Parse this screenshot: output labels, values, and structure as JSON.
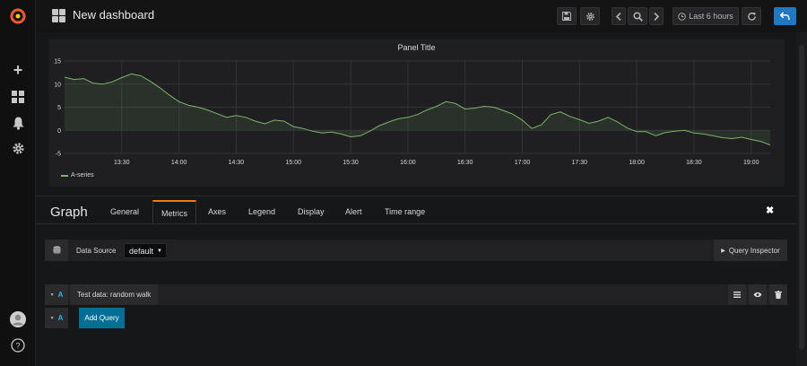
{
  "topbar": {
    "title": "New dashboard",
    "time_range": "Last 6 hours"
  },
  "panel": {
    "title": "Panel Title"
  },
  "chart_data": {
    "type": "line",
    "x": [
      "13:00",
      "13:05",
      "13:10",
      "13:15",
      "13:20",
      "13:25",
      "13:30",
      "13:35",
      "13:40",
      "13:45",
      "13:50",
      "13:55",
      "14:00",
      "14:05",
      "14:10",
      "14:15",
      "14:20",
      "14:25",
      "14:30",
      "14:35",
      "14:40",
      "14:45",
      "14:50",
      "14:55",
      "15:00",
      "15:05",
      "15:10",
      "15:15",
      "15:20",
      "15:25",
      "15:30",
      "15:35",
      "15:40",
      "15:45",
      "15:50",
      "15:55",
      "16:00",
      "16:05",
      "16:10",
      "16:15",
      "16:20",
      "16:25",
      "16:30",
      "16:35",
      "16:40",
      "16:45",
      "16:50",
      "16:55",
      "17:00",
      "17:05",
      "17:10",
      "17:15",
      "17:20",
      "17:25",
      "17:30",
      "17:35",
      "17:40",
      "17:45",
      "17:50",
      "17:55",
      "18:00",
      "18:05",
      "18:10",
      "18:15",
      "18:20",
      "18:25",
      "18:30",
      "18:35",
      "18:40",
      "18:45",
      "18:50",
      "18:55",
      "19:00",
      "19:05",
      "19:10"
    ],
    "series": [
      {
        "name": "A-series",
        "values": [
          11.5,
          11,
          11.2,
          10.2,
          10,
          10.5,
          11.4,
          12.2,
          11.8,
          10.6,
          9.2,
          7.6,
          6.2,
          5.4,
          5,
          4.4,
          3.6,
          2.8,
          3.2,
          2.8,
          2,
          1.4,
          2.2,
          2,
          0.8,
          0.4,
          -0.2,
          -0.6,
          -0.4,
          -0.8,
          -1.4,
          -1.2,
          -0.2,
          1,
          1.8,
          2.5,
          2.8,
          3.4,
          4.4,
          5.2,
          6.2,
          5.8,
          4.6,
          4.8,
          5.2,
          5,
          4.3,
          3.5,
          2.2,
          0.4,
          1.2,
          3.4,
          4,
          3,
          2.3,
          1.5,
          2,
          2.8,
          1.8,
          0.5,
          -0.3,
          -0.3,
          -1.2,
          -0.5,
          -0.2,
          0,
          -0.6,
          -0.8,
          -1.2,
          -1.6,
          -1.8,
          -1.5,
          -2,
          -2.4,
          -3.2
        ]
      }
    ],
    "yticks": [
      "15",
      "10",
      "5",
      "0",
      "-5"
    ],
    "xticks": [
      "13:30",
      "14:00",
      "14:30",
      "15:00",
      "15:30",
      "16:00",
      "16:30",
      "17:00",
      "17:30",
      "18:00",
      "18:30",
      "19:00"
    ],
    "ylim": [
      -5,
      15
    ],
    "grid": true,
    "legend": "bottom-left",
    "colors": {
      "line": "#7eb26d"
    }
  },
  "editor": {
    "title": "Graph",
    "tabs": [
      "General",
      "Metrics",
      "Axes",
      "Legend",
      "Display",
      "Alert",
      "Time range"
    ],
    "active_tab": "Metrics",
    "datasource_label": "Data Source",
    "datasource_value": "default",
    "query_inspector": "Query Inspector",
    "query_letter": "A",
    "query_scenario": "Test data: random walk",
    "add_letter": "A",
    "add_query": "Add Query"
  },
  "colors": {
    "accent": "#eb7b18",
    "primary": "#1f78c1",
    "add": "#006e95"
  }
}
